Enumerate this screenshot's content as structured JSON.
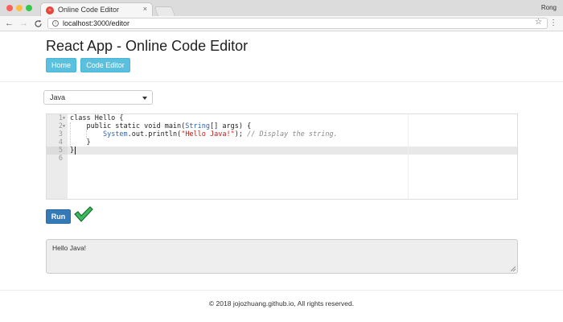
{
  "browser": {
    "tab_title": "Online Code Editor",
    "tab_close": "×",
    "user_name": "Rong",
    "url": "localhost:3000/editor",
    "back_icon": "←",
    "forward_icon": "→",
    "reload_icon": "C",
    "star_icon": "☆",
    "menu_icon": "⋮"
  },
  "page": {
    "title": "React App - Online Code Editor",
    "nav": {
      "home": "Home",
      "code_editor": "Code Editor"
    }
  },
  "language": {
    "selected": "Java"
  },
  "editor": {
    "line_numbers": [
      "1",
      "2",
      "3",
      "4",
      "5",
      "6"
    ],
    "lines": [
      [
        {
          "t": "class Hello {",
          "c": "kw"
        }
      ],
      [
        {
          "t": "    public static void main(",
          "c": "kw"
        },
        {
          "t": "String",
          "c": "tp"
        },
        {
          "t": "[] args) {",
          "c": "kw"
        }
      ],
      [
        {
          "t": "        ",
          "c": "kw"
        },
        {
          "t": "System",
          "c": "tp"
        },
        {
          "t": ".out.println(",
          "c": "kw"
        },
        {
          "t": "\"Hello Java!\"",
          "c": "str"
        },
        {
          "t": "); ",
          "c": "kw"
        },
        {
          "t": "// Display the string.",
          "c": "cm"
        }
      ],
      [
        {
          "t": "    }",
          "c": "kw"
        }
      ],
      [
        {
          "t": "}",
          "c": "kw"
        }
      ],
      [
        {
          "t": "",
          "c": "kw"
        }
      ]
    ]
  },
  "run": {
    "label": "Run",
    "status": "success"
  },
  "output": {
    "text": "Hello Java!"
  },
  "footer": {
    "text": "© 2018 jojozhuang.github.io, All rights reserved."
  },
  "colors": {
    "nav_button": "#5bc0de",
    "run_button": "#337ab7",
    "check": "#2ea44f"
  }
}
